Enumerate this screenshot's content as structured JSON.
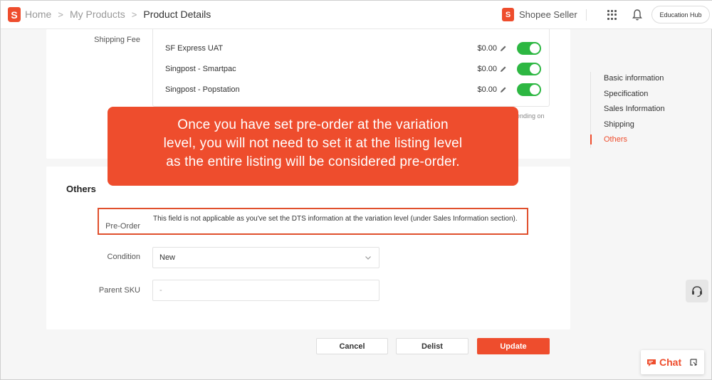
{
  "breadcrumb": {
    "home": "Home",
    "products": "My Products",
    "current": "Product Details"
  },
  "brand": {
    "label": "Shopee Seller"
  },
  "header": {
    "education_hub": "Education Hub"
  },
  "shipping": {
    "label": "Shipping Fee",
    "rows": [
      {
        "name": "SF Express UAT",
        "fee": "$0.00",
        "enabled": true
      },
      {
        "name": "Singpost - Smartpac",
        "fee": "$0.00",
        "enabled": true
      },
      {
        "name": "Singpost - Popstation",
        "fee": "$0.00",
        "enabled": true
      }
    ],
    "pending_partial": "ending on"
  },
  "others": {
    "title": "Others",
    "preorder": {
      "label": "Pre-Order",
      "note": "This field is not applicable as you've set the DTS information at the variation level (under Sales Information section)."
    },
    "condition": {
      "label": "Condition",
      "value": "New"
    },
    "parent_sku": {
      "label": "Parent SKU",
      "value": "-"
    }
  },
  "actions": {
    "cancel": "Cancel",
    "delist": "Delist",
    "update": "Update"
  },
  "side_nav": {
    "items": [
      "Basic information",
      "Specification",
      "Sales Information",
      "Shipping",
      "Others"
    ],
    "active": "Others"
  },
  "chat": {
    "label": "Chat"
  },
  "callout": {
    "lines": [
      "Once you have set pre-order at the variation",
      "level, you will not need to set it at the listing level",
      "as the entire listing will be considered pre-order."
    ]
  },
  "colors": {
    "accent": "#ee4d2d",
    "toggle_on": "#2db742",
    "highlight_border": "#e0502d"
  }
}
